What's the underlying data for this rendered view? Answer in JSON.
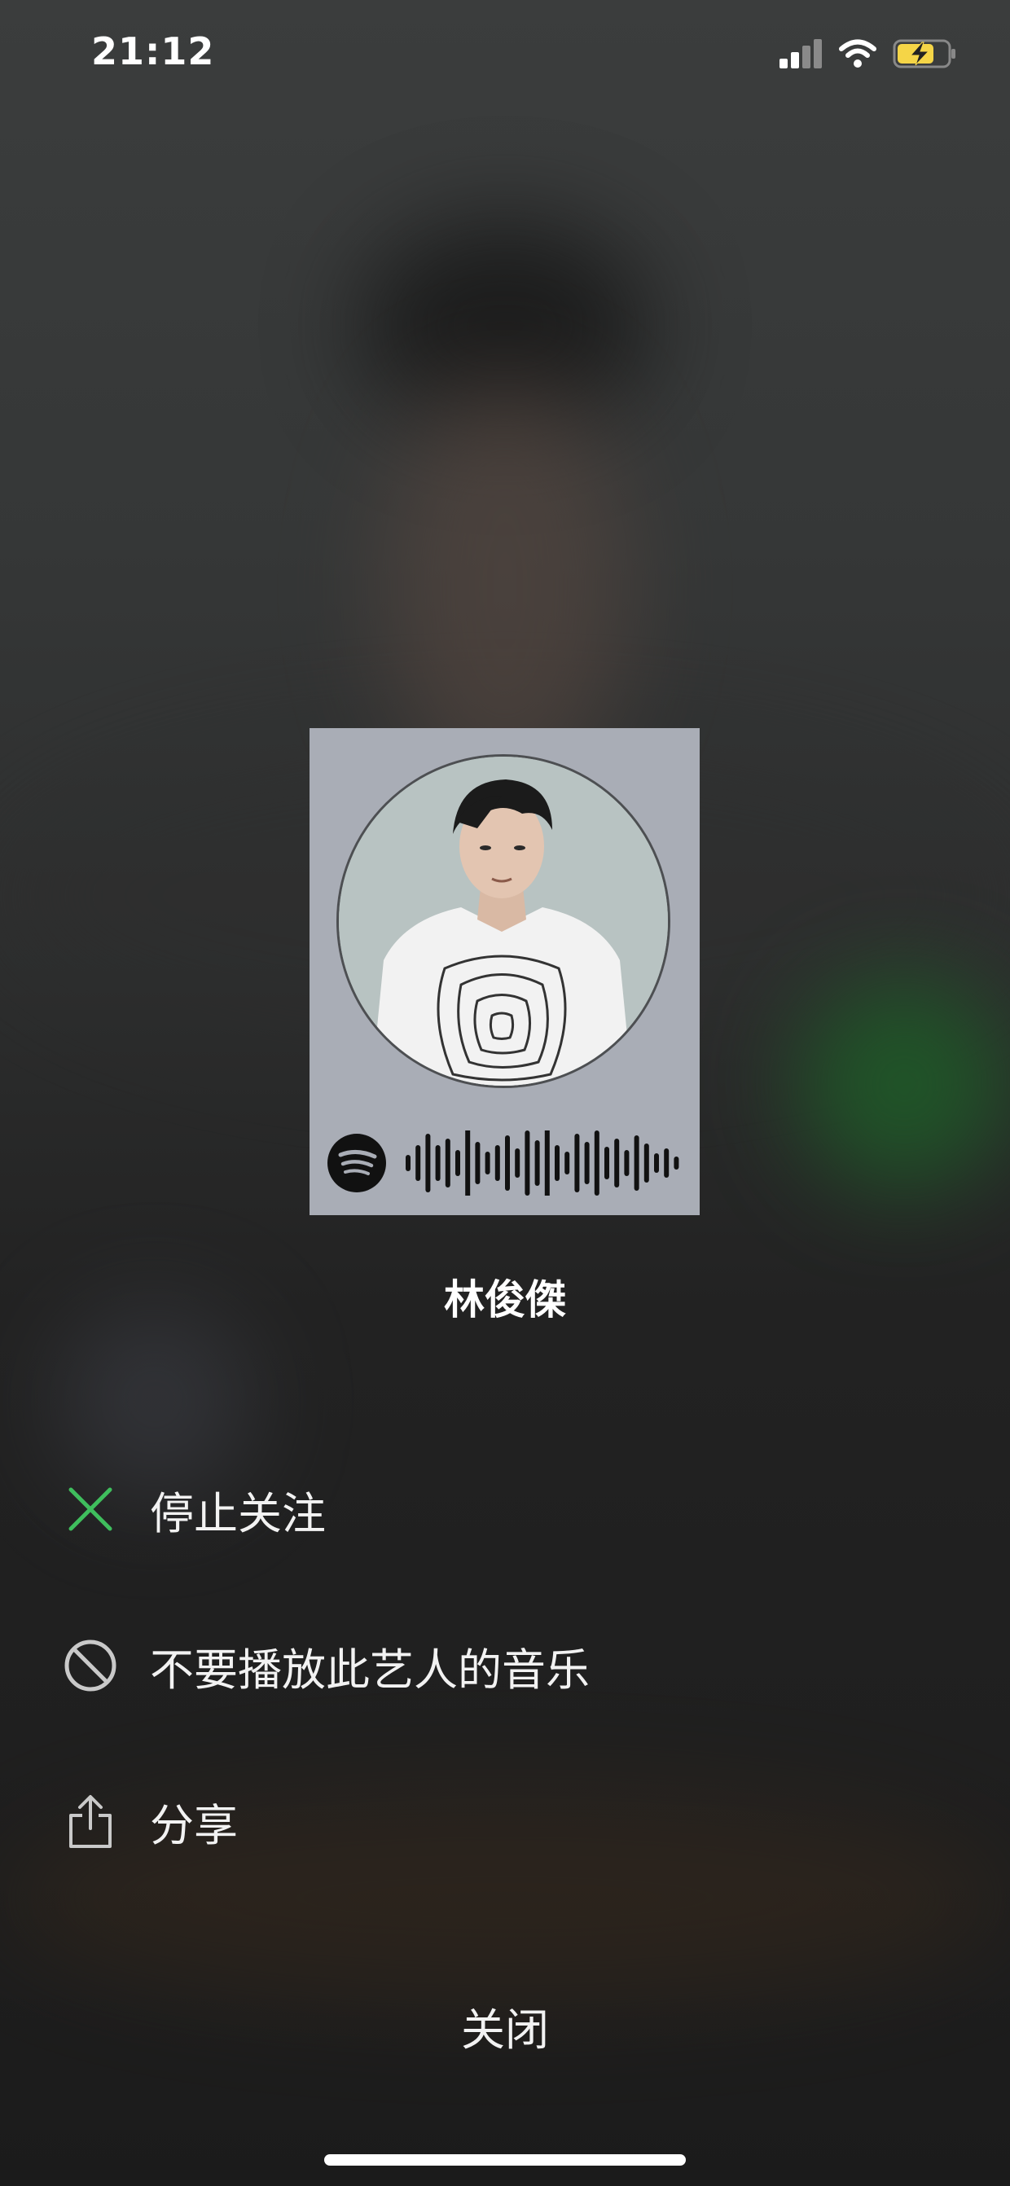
{
  "status_bar": {
    "time": "21:12",
    "signal_icon": "cellular-signal-icon",
    "wifi_icon": "wifi-icon",
    "battery_icon": "battery-charging-icon",
    "battery_color": "#f5d547"
  },
  "card": {
    "artist_image": "artist-portrait",
    "logo_icon": "spotify-logo-icon",
    "code_graphic": "spotify-code-bars",
    "background_color": "#a9adb6"
  },
  "artist_name": "林俊傑",
  "menu": {
    "items": [
      {
        "label": "停止关注",
        "icon": "close-x-icon",
        "icon_color": "#3fbe5d"
      },
      {
        "label": "不要播放此艺人的音乐",
        "icon": "block-icon",
        "icon_color": "#c9c9c9"
      },
      {
        "label": "分享",
        "icon": "share-icon",
        "icon_color": "#c9c9c9"
      }
    ]
  },
  "close_label": "关闭"
}
